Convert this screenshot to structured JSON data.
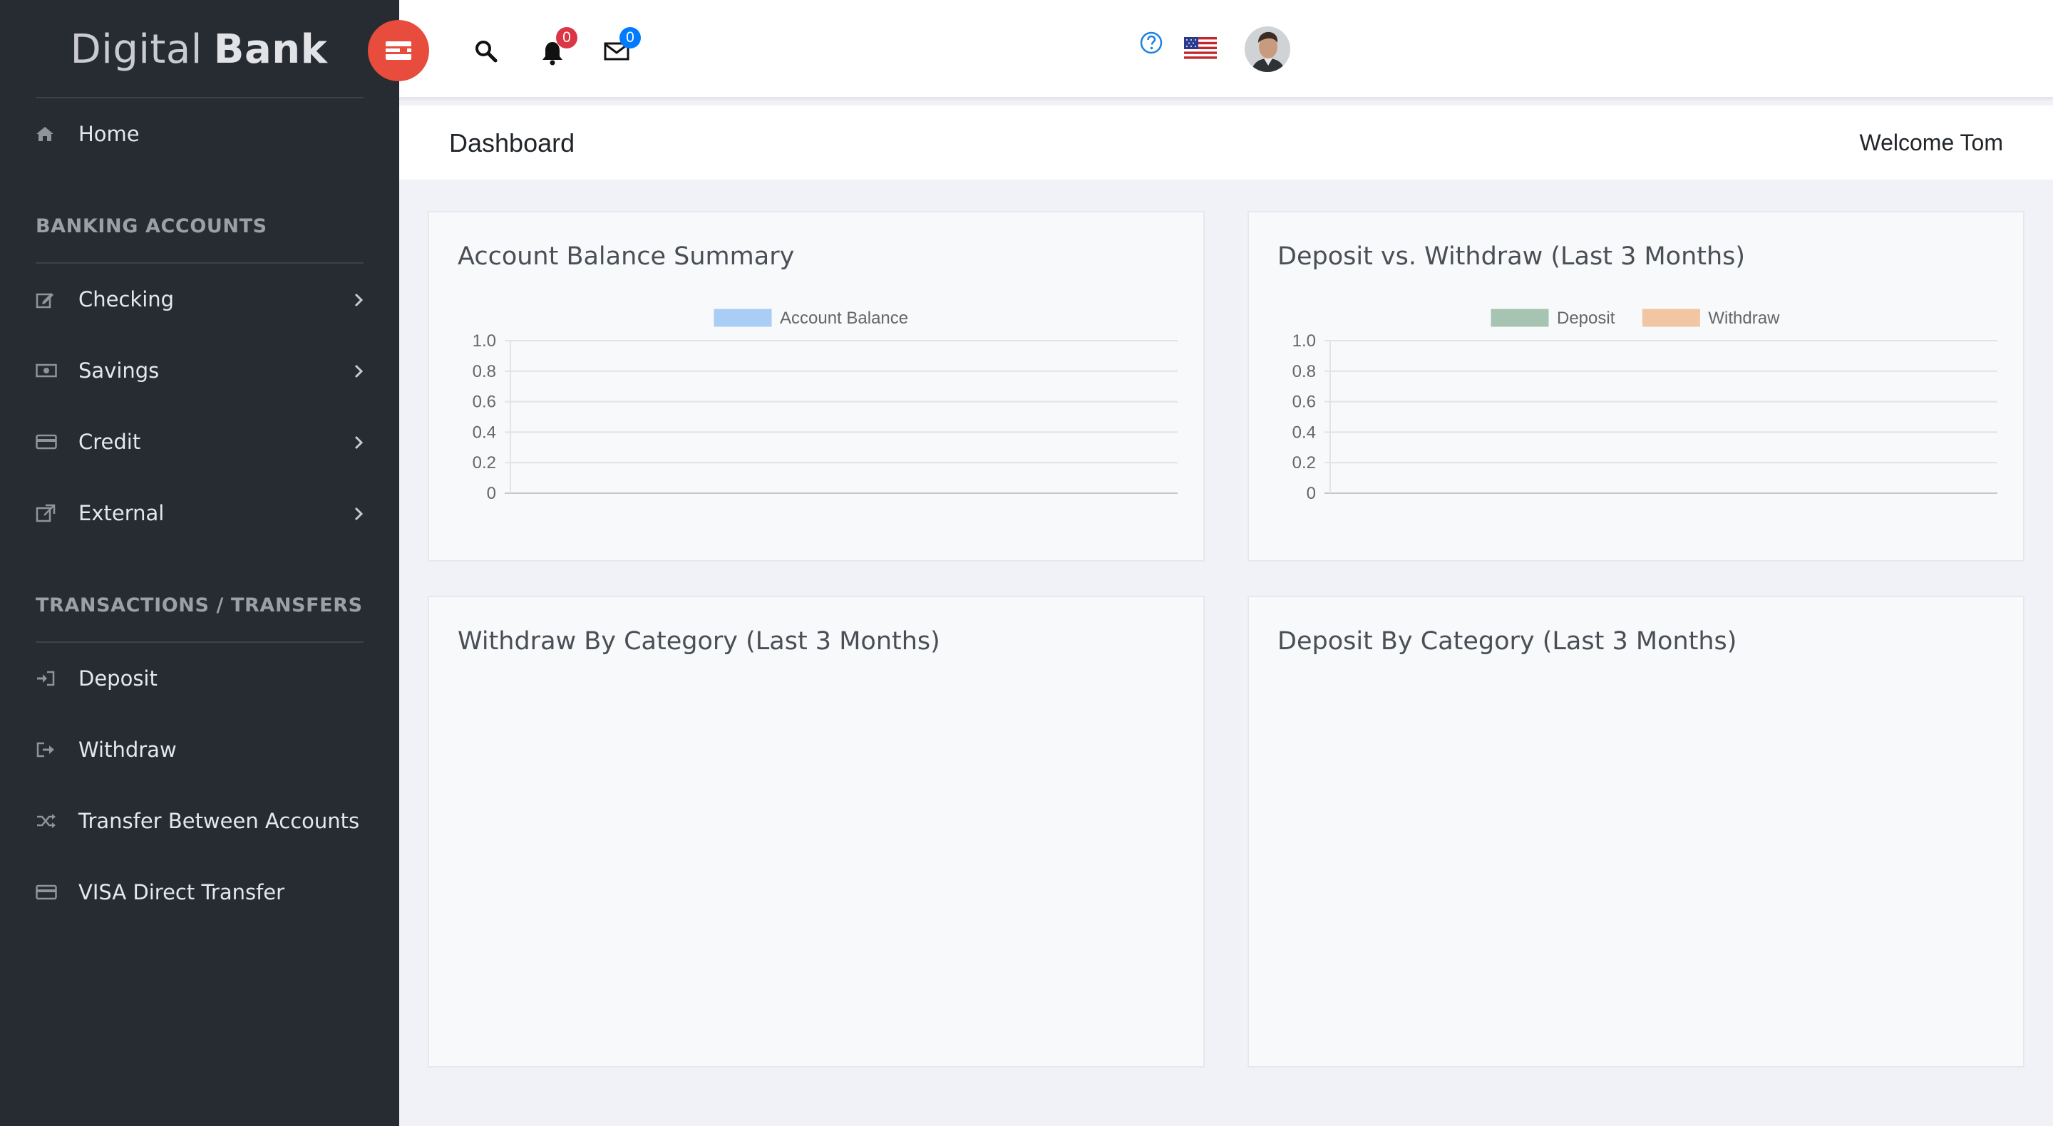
{
  "brand": {
    "light": "Digital",
    "bold": "Bank"
  },
  "sidebar": {
    "home": {
      "label": "Home",
      "icon": "home-icon"
    },
    "sections": [
      {
        "title": "BANKING ACCOUNTS",
        "items": [
          {
            "label": "Checking",
            "icon": "edit-icon"
          },
          {
            "label": "Savings",
            "icon": "money-icon"
          },
          {
            "label": "Credit",
            "icon": "credit-card-icon"
          },
          {
            "label": "External",
            "icon": "external-link-icon"
          }
        ]
      },
      {
        "title": "TRANSACTIONS / TRANSFERS",
        "items": [
          {
            "label": "Deposit",
            "icon": "sign-in-icon"
          },
          {
            "label": "Withdraw",
            "icon": "sign-out-icon"
          },
          {
            "label": "Transfer Between Accounts",
            "icon": "shuffle-icon"
          },
          {
            "label": "VISA Direct Transfer",
            "icon": "credit-card-icon"
          }
        ]
      }
    ]
  },
  "header": {
    "notifications_count": "0",
    "messages_count": "0",
    "colors": {
      "accent": "#e74c3c",
      "notif_badge": "#dc3545",
      "msg_badge": "#007bff"
    }
  },
  "titlebar": {
    "title": "Dashboard",
    "welcome": "Welcome Tom"
  },
  "cards": {
    "balance": {
      "title": "Account Balance Summary"
    },
    "deposit_withdraw": {
      "title": "Deposit vs. Withdraw (Last 3 Months)"
    },
    "withdraw_category": {
      "title": "Withdraw By Category (Last 3 Months)"
    },
    "deposit_category": {
      "title": "Deposit By Category (Last 3 Months)"
    }
  },
  "chart_data": [
    {
      "type": "bar",
      "title": "Account Balance Summary",
      "categories": [],
      "series": [
        {
          "name": "Account Balance",
          "values": [],
          "color": "#a9cdf5"
        }
      ],
      "ylim": [
        0,
        1.0
      ],
      "yticks": [
        "1.0",
        "0.8",
        "0.6",
        "0.4",
        "0.2",
        "0"
      ],
      "legend": "top-center",
      "grid": true
    },
    {
      "type": "bar",
      "title": "Deposit vs. Withdraw (Last 3 Months)",
      "categories": [],
      "series": [
        {
          "name": "Deposit",
          "values": [],
          "color": "#a7c4b3"
        },
        {
          "name": "Withdraw",
          "values": [],
          "color": "#f2c6a2"
        }
      ],
      "ylim": [
        0,
        1.0
      ],
      "yticks": [
        "1.0",
        "0.8",
        "0.6",
        "0.4",
        "0.2",
        "0"
      ],
      "legend": "top-center",
      "grid": true
    }
  ]
}
